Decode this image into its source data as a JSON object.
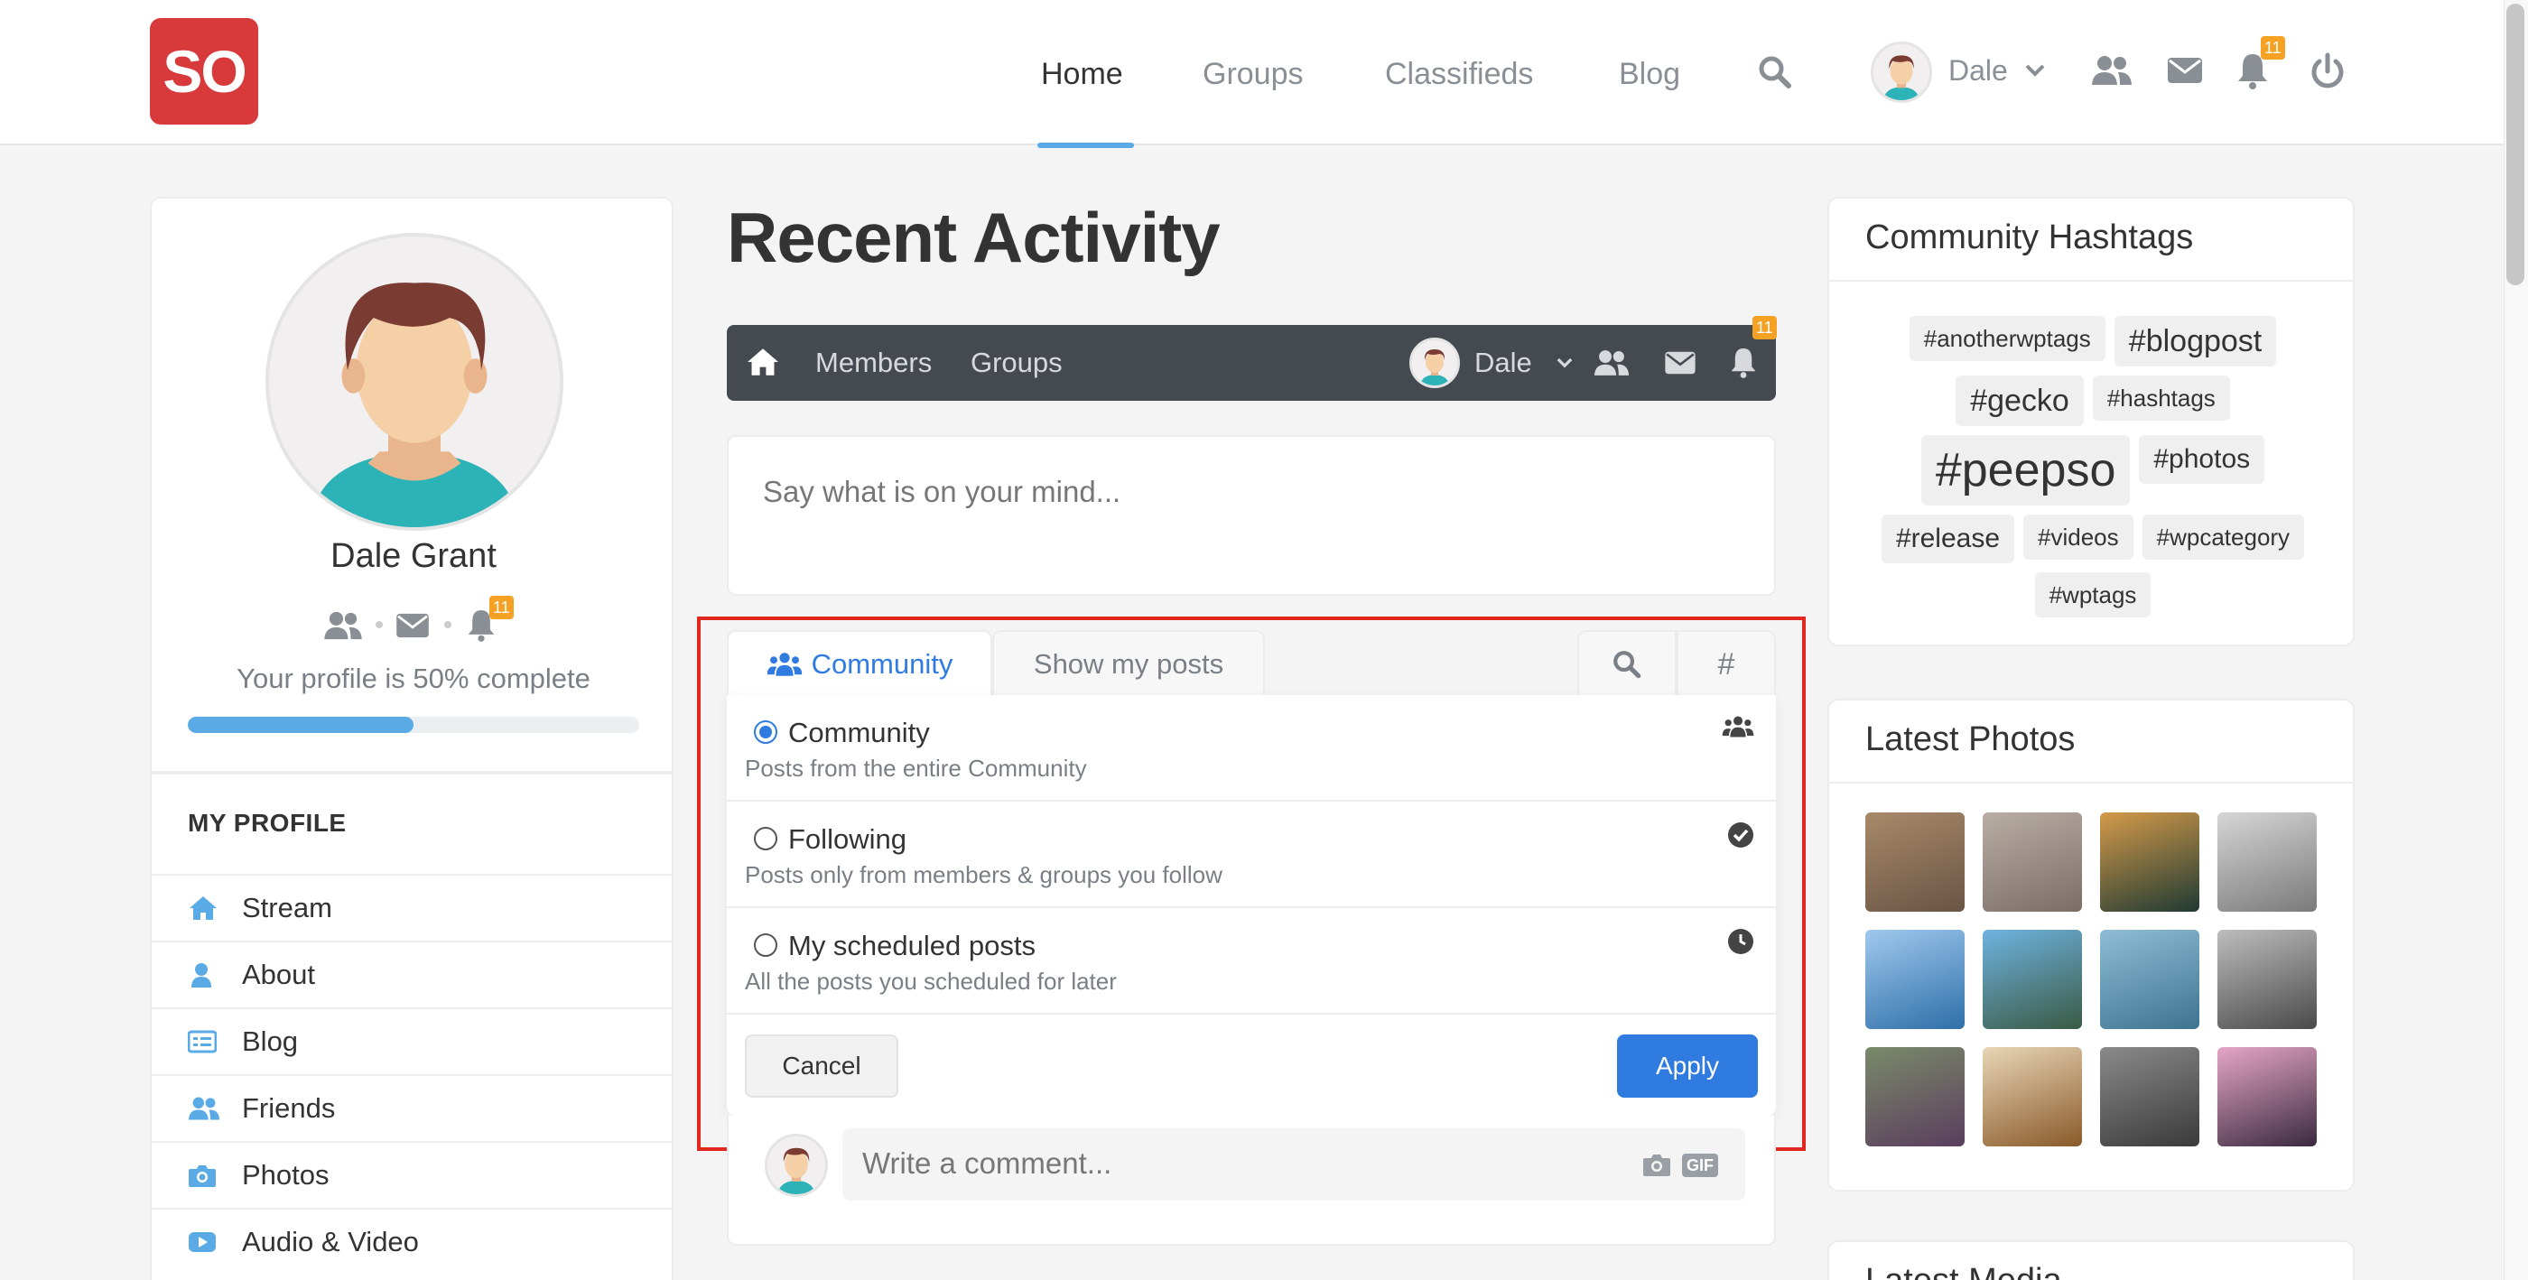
{
  "header": {
    "logo_text": "SO",
    "nav": [
      "Home",
      "Groups",
      "Classifieds",
      "Blog"
    ],
    "active_nav": "Home",
    "user_name": "Dale",
    "notification_count": "11",
    "icons": [
      "search-icon",
      "chevron-down-icon",
      "friends-icon",
      "mail-icon",
      "bell-icon",
      "power-icon"
    ]
  },
  "profile": {
    "name": "Dale Grant",
    "notification_count": "11",
    "completion_text": "Your profile is 50% complete",
    "completion_fraction": 0.5,
    "section_title": "MY PROFILE",
    "menu": [
      {
        "label": "Stream",
        "icon": "home-icon"
      },
      {
        "label": "About",
        "icon": "user-icon"
      },
      {
        "label": "Blog",
        "icon": "list-icon"
      },
      {
        "label": "Friends",
        "icon": "friends-icon"
      },
      {
        "label": "Photos",
        "icon": "camera-icon"
      },
      {
        "label": "Audio & Video",
        "icon": "youtube-icon"
      }
    ]
  },
  "main": {
    "title": "Recent Activity",
    "subnav": {
      "items": [
        "Members",
        "Groups"
      ],
      "user_name": "Dale",
      "notification_count": "11"
    },
    "compose_placeholder": "Say what is on your mind...",
    "tabs": {
      "active": "Community",
      "other": "Show my posts"
    },
    "filter_options": [
      {
        "label": "Community",
        "description": "Posts from the entire Community",
        "checked": true,
        "icon": "community-icon"
      },
      {
        "label": "Following",
        "description": "Posts only from members & groups you follow",
        "checked": false,
        "icon": "check-circle-icon"
      },
      {
        "label": "My scheduled posts",
        "description": "All the posts you scheduled for later",
        "checked": false,
        "icon": "clock-icon"
      }
    ],
    "cancel_label": "Cancel",
    "apply_label": "Apply",
    "comment_placeholder": "Write a comment...",
    "gif_label": "GIF"
  },
  "sidebar_right": {
    "hashtags_title": "Community Hashtags",
    "hashtags": [
      {
        "tag": "#anotherwptags",
        "size": "small"
      },
      {
        "tag": "#blogpost",
        "size": "medium"
      },
      {
        "tag": "#gecko",
        "size": "medium"
      },
      {
        "tag": "#hashtags",
        "size": "small"
      },
      {
        "tag": "#peepso",
        "size": "large"
      },
      {
        "tag": "#photos",
        "size": "medium-small"
      },
      {
        "tag": "#release",
        "size": "medium-small"
      },
      {
        "tag": "#videos",
        "size": "small"
      },
      {
        "tag": "#wpcategory",
        "size": "small"
      },
      {
        "tag": "#wptags",
        "size": "small"
      }
    ],
    "photos_title": "Latest Photos",
    "photos": [
      {
        "name": "laptop",
        "colors": [
          "#a88a6a",
          "#6a5444"
        ]
      },
      {
        "name": "cat",
        "colors": [
          "#b9aea4",
          "#7a6e66"
        ]
      },
      {
        "name": "forest-sunset",
        "colors": [
          "#d49a4a",
          "#1f3a33"
        ]
      },
      {
        "name": "bw-landscape",
        "colors": [
          "#d6d6d6",
          "#7a7a7a"
        ]
      },
      {
        "name": "sea-city",
        "colors": [
          "#9fc9ee",
          "#2f6fa8"
        ]
      },
      {
        "name": "sky-rocks",
        "colors": [
          "#6fb3e0",
          "#3a5a44"
        ]
      },
      {
        "name": "sea-horizon",
        "colors": [
          "#8fbdd6",
          "#3d7490"
        ]
      },
      {
        "name": "lighthouse",
        "colors": [
          "#bdbdbd",
          "#4a4a4a"
        ]
      },
      {
        "name": "forest-path",
        "colors": [
          "#7a8a6a",
          "#5a3e5e"
        ]
      },
      {
        "name": "book",
        "colors": [
          "#e8d6b6",
          "#8a5a2a"
        ]
      },
      {
        "name": "bw-grass",
        "colors": [
          "#8a8a8a",
          "#3a3a3a"
        ]
      },
      {
        "name": "blossom",
        "colors": [
          "#e6a6c6",
          "#3a2a3e"
        ]
      }
    ],
    "latest_media_title": "Latest Media"
  },
  "colors": {
    "brand_red": "#d8393a",
    "accent_blue": "#2f7be0",
    "progress_blue": "#5aabe5",
    "badge_orange": "#f4a124",
    "subnav_bg": "#454a51",
    "highlight_red": "#e0281e"
  }
}
